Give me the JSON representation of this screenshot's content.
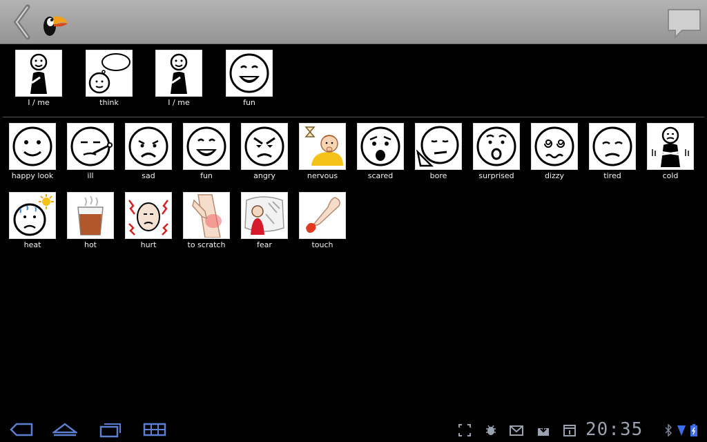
{
  "sentence": {
    "items": [
      {
        "label": "I / me",
        "icon": "person-pointing-self-icon"
      },
      {
        "label": "think",
        "icon": "thinking-person-icon"
      },
      {
        "label": "I / me",
        "icon": "person-pointing-self-icon"
      },
      {
        "label": "fun",
        "icon": "fun-face-icon"
      }
    ]
  },
  "grid": {
    "items": [
      {
        "label": "happy look",
        "icon": "happy-face-icon"
      },
      {
        "label": "ill",
        "icon": "ill-face-icon"
      },
      {
        "label": "sad",
        "icon": "sad-face-icon"
      },
      {
        "label": "fun",
        "icon": "fun-face-icon"
      },
      {
        "label": "angry",
        "icon": "angry-face-icon"
      },
      {
        "label": "nervous",
        "icon": "nervous-person-icon"
      },
      {
        "label": "scared",
        "icon": "scared-face-icon"
      },
      {
        "label": "bore",
        "icon": "bored-face-icon"
      },
      {
        "label": "surprised",
        "icon": "surprised-face-icon"
      },
      {
        "label": "dizzy",
        "icon": "dizzy-face-icon"
      },
      {
        "label": "tired",
        "icon": "tired-face-icon"
      },
      {
        "label": "cold",
        "icon": "cold-person-icon"
      },
      {
        "label": "heat",
        "icon": "heat-face-icon"
      },
      {
        "label": "hot",
        "icon": "hot-drink-icon"
      },
      {
        "label": "hurt",
        "icon": "hurt-face-icon"
      },
      {
        "label": "to scratch",
        "icon": "scratching-arm-icon"
      },
      {
        "label": "fear",
        "icon": "fear-person-icon"
      },
      {
        "label": "touch",
        "icon": "touching-finger-icon"
      }
    ]
  },
  "status": {
    "time": "20:35"
  },
  "colors": {
    "topbar": "#a8a8a8",
    "status_icons": "#9aa2b0",
    "battery": "#3b6ee8"
  }
}
